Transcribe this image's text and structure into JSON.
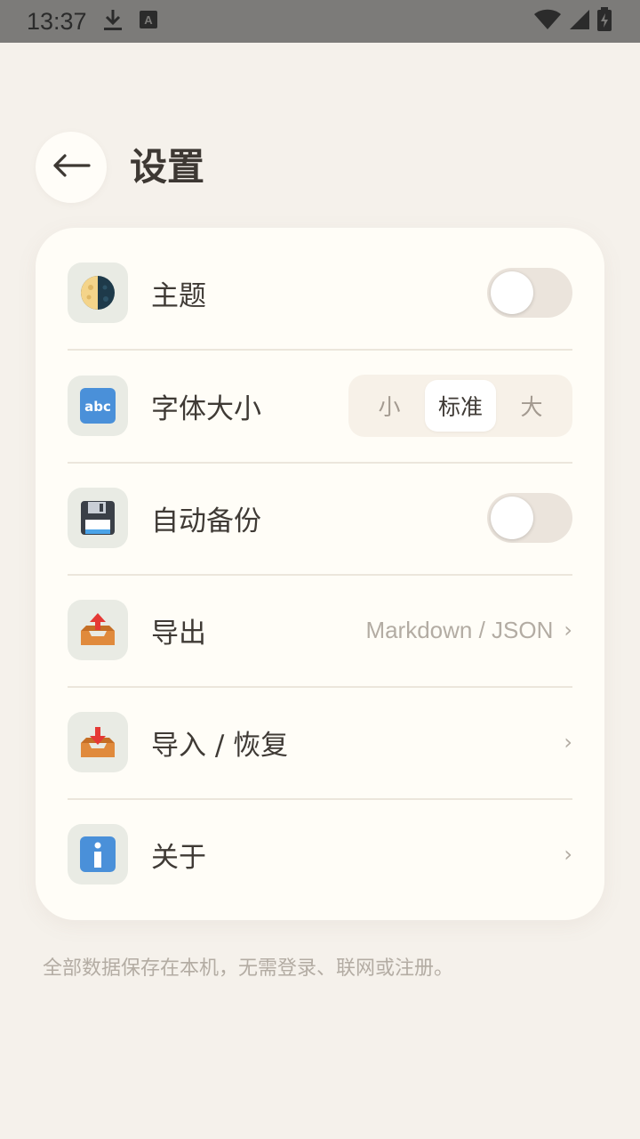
{
  "status_bar": {
    "time": "13:37",
    "icons": [
      "download-icon",
      "app-a-icon",
      "wifi-icon",
      "signal-icon",
      "battery-charging-icon"
    ]
  },
  "header": {
    "back_icon": "arrow-left-icon",
    "title": "设置"
  },
  "settings": {
    "theme": {
      "icon": "half-moon-icon",
      "label": "主题",
      "enabled": false
    },
    "font_size": {
      "icon": "abc-icon",
      "label": "字体大小",
      "options": [
        "小",
        "标准",
        "大"
      ],
      "selected": "标准"
    },
    "auto_backup": {
      "icon": "floppy-disk-icon",
      "label": "自动备份",
      "enabled": false
    },
    "export": {
      "icon": "outbox-tray-icon",
      "label": "导出",
      "value": "Markdown / JSON",
      "chevron": "›"
    },
    "import": {
      "icon": "inbox-tray-icon",
      "label": "导入 / 恢复",
      "chevron": "›"
    },
    "about": {
      "icon": "info-icon",
      "label": "关于",
      "chevron": "›"
    }
  },
  "footer": {
    "note": "全部数据保存在本机，无需登录、联网或注册。"
  },
  "colors": {
    "background": "#f5f1eb",
    "card": "#fffdf7",
    "text": "#3f3a35",
    "muted": "#b3aca3",
    "toggle_track": "#ebe4dc",
    "icon_tile": "#e9ebe4"
  }
}
